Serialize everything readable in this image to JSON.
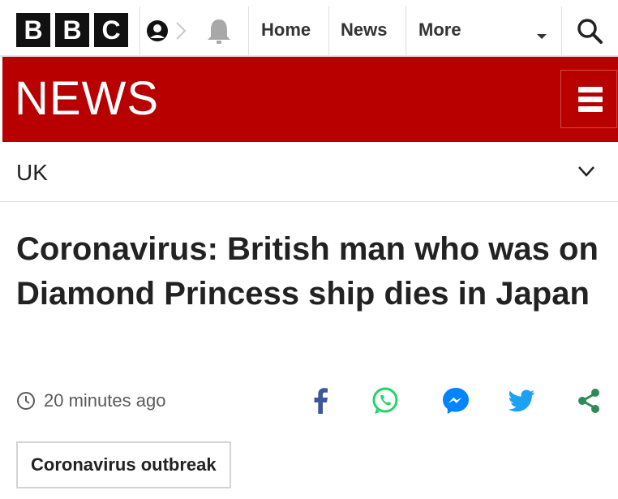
{
  "header": {
    "logo_letters": [
      "B",
      "B",
      "C"
    ],
    "nav": {
      "home_label": "Home",
      "news_label": "News",
      "more_label": "More"
    },
    "icons": [
      "account-icon",
      "notifications-bell-icon",
      "search-icon",
      "chevron-down-icon"
    ]
  },
  "banner": {
    "wordmark": "NEWS",
    "background_color": "#b80000",
    "menu_icon": "hamburger-menu-icon"
  },
  "section": {
    "label": "UK",
    "expand_icon": "chevron-down-icon"
  },
  "article": {
    "headline": "Coronavirus: British man who was on Diamond Princess ship dies in Japan",
    "timestamp": "20 minutes ago",
    "share_icons": [
      "facebook-icon",
      "whatsapp-icon",
      "messenger-icon",
      "twitter-icon",
      "share-icon"
    ],
    "topic_tag": "Coronavirus outbreak"
  },
  "colors": {
    "brand_red": "#b80000",
    "facebook_blue": "#3b5998",
    "whatsapp_green": "#25d366",
    "messenger_blue": "#0084ff",
    "twitter_blue": "#1da1f2",
    "share_green": "#2e8b57"
  }
}
